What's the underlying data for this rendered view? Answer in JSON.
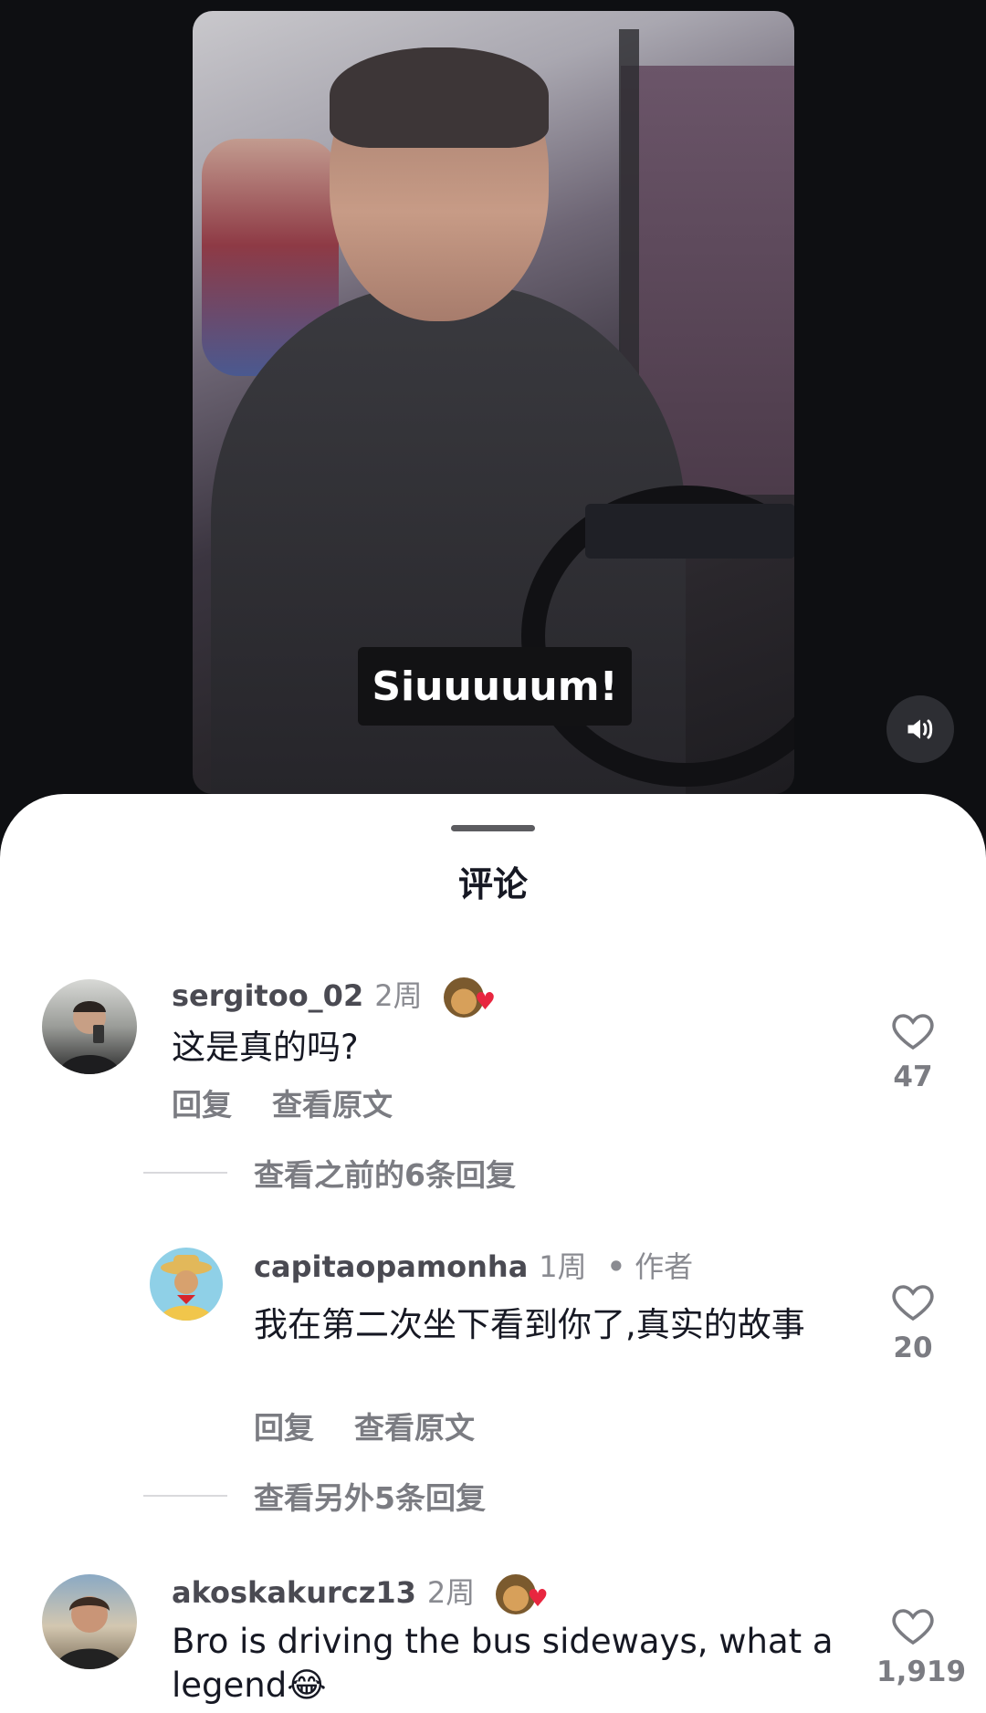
{
  "video": {
    "subtitle": "Siuuuuum!",
    "sound_icon": "speaker-icon"
  },
  "sheet": {
    "title": "评论"
  },
  "comments": [
    {
      "username": "sergitoo_02",
      "time": "2周",
      "text": "这是真的吗?",
      "reply_label": "回复",
      "view_original_label": "查看原文",
      "likes": "47"
    },
    {
      "username": "capitaopamonha",
      "time": "1周",
      "author_label": "作者",
      "text": "我在第二次坐下看到你了,真实的故事",
      "reply_label": "回复",
      "view_original_label": "查看原文",
      "likes": "20"
    },
    {
      "username": "akoskakurcz13",
      "time": "2周",
      "text": "Bro is driving the bus sideways, what a legend😂",
      "likes": "1,919"
    }
  ],
  "view_more": [
    "查看之前的6条回复",
    "查看另外5条回复"
  ]
}
